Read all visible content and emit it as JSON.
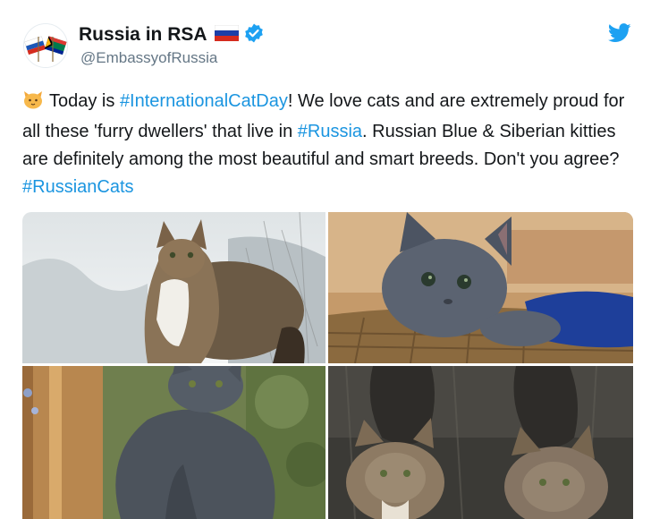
{
  "tweet": {
    "display_name": "Russia in RSA",
    "handle": "@EmbassyofRussia",
    "text_parts": {
      "p1": "Today is ",
      "h1": "#InternationalCatDay",
      "p2": "! We love cats and are extremely proud for all these 'furry dwellers' that live in ",
      "h2": "#Russia",
      "p3": ". Russian Blue & Siberian kitties are definitely among the most beautiful and smart breeds. Don't you agree? ",
      "h3": "#RussianCats"
    },
    "icons": {
      "avatar": "russia-south-africa-flags-icon",
      "flag": "russia-flag-icon",
      "verified": "verified-badge-icon",
      "brand": "twitter-bird-icon",
      "emoji": "cat-face-emoji-icon"
    },
    "colors": {
      "link": "#1b95e0",
      "verified": "#1da1f2",
      "handle": "#657786"
    }
  }
}
